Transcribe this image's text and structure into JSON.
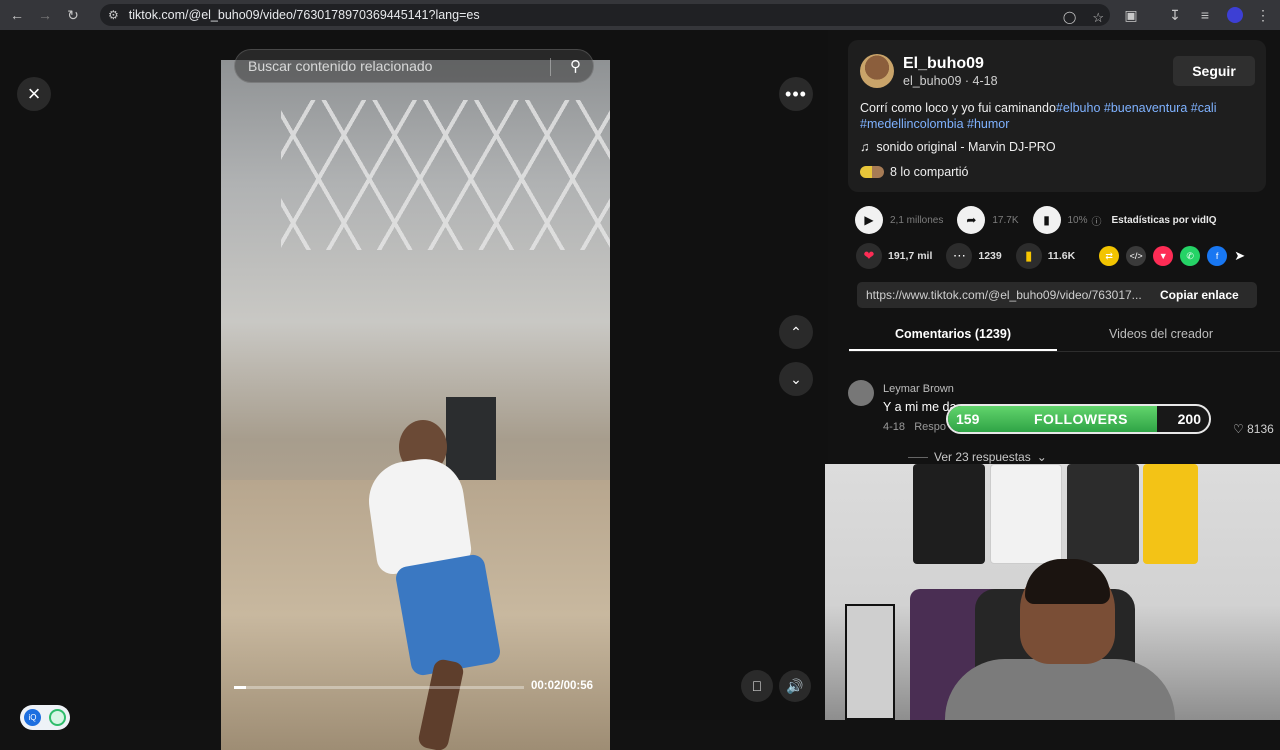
{
  "browser": {
    "url": "tiktok.com/@el_buho09/video/7630178970369445141?lang=es"
  },
  "video": {
    "search_placeholder": "Buscar contenido relacionado",
    "time": "00:02/00:56",
    "progress": 0.04
  },
  "post": {
    "author_name": "El_buho09",
    "author_sub": "el_buho09 · 4-18",
    "follow_label": "Seguir",
    "desc_text": "Corrí como loco y yo fui caminando",
    "hashtags_line1": "#elbuho #buenaventura #cali",
    "hashtags_line2": "#medellincolombia #humor",
    "music": "sonido original - Marvin DJ-PRO",
    "shares_text": "8 lo compartió"
  },
  "stats": {
    "views": "2,1 millones",
    "shares": "17.7K",
    "rate": "10%",
    "vidiq_label": "Estadísticas por vidIQ"
  },
  "actions": {
    "likes": "191,7 mil",
    "comments": "1239",
    "saves": "11.6K"
  },
  "link": {
    "url": "https://www.tiktok.com/@el_buho09/video/763017...",
    "copy_label": "Copiar enlace"
  },
  "tabs": [
    {
      "label": "Comentarios (1239)"
    },
    {
      "label": "Videos del creador"
    }
  ],
  "comment": {
    "user": "Leymar Brown",
    "text": "Y a mi me da",
    "date": "4-18",
    "reply": "Respo",
    "likes": "8136",
    "more_replies": "Ver 23 respuestas"
  },
  "followers_goal": {
    "current": "159",
    "label": "FOLLOWERS",
    "goal": "200",
    "progress": 0.8
  },
  "colors": {
    "accent_tag": "#7fb2ff",
    "like_red": "#fe2c55",
    "bookmark_yellow": "#f7c600",
    "goal_green": "#2fa446"
  }
}
